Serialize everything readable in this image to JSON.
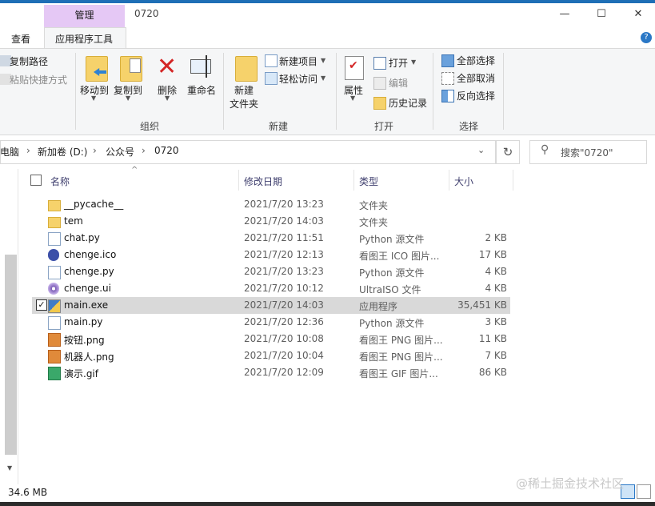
{
  "window": {
    "context_group": "管理",
    "title": "0720",
    "tabs": [
      "查看",
      "应用程序工具"
    ]
  },
  "ribbon": {
    "clipboard_items": [
      "复制路径",
      "粘贴快捷方式"
    ],
    "organize": {
      "buttons": [
        "移动到",
        "复制到",
        "删除",
        "重命名"
      ],
      "group": "组织"
    },
    "new": {
      "new_folder_line1": "新建",
      "new_folder_line2": "文件夹",
      "new_item": "新建项目",
      "easy_access": "轻松访问",
      "group": "新建"
    },
    "open": {
      "properties": "属性",
      "open": "打开",
      "edit": "编辑",
      "history": "历史记录",
      "group": "打开"
    },
    "select": {
      "select_all": "全部选择",
      "select_none": "全部取消",
      "invert": "反向选择",
      "group": "选择"
    }
  },
  "address": {
    "crumbs": [
      "电脑",
      "新加卷 (D:)",
      "公众号",
      "0720"
    ],
    "search_placeholder": "搜索\"0720\""
  },
  "columns": {
    "name": "名称",
    "date": "修改日期",
    "type": "类型",
    "size": "大小"
  },
  "files": [
    {
      "name": "__pycache__",
      "date": "2021/7/20 13:23",
      "type": "文件夹",
      "size": "",
      "icon": "folder-icon"
    },
    {
      "name": "tem",
      "date": "2021/7/20 14:03",
      "type": "文件夹",
      "size": "",
      "icon": "folder-icon"
    },
    {
      "name": "chat.py",
      "date": "2021/7/20 11:51",
      "type": "Python 源文件",
      "size": "2 KB",
      "icon": "python-file-icon"
    },
    {
      "name": "chenge.ico",
      "date": "2021/7/20 12:13",
      "type": "看图王 ICO 图片...",
      "size": "17 KB",
      "icon": "ico-file-icon"
    },
    {
      "name": "chenge.py",
      "date": "2021/7/20 13:23",
      "type": "Python 源文件",
      "size": "4 KB",
      "icon": "python-file-icon"
    },
    {
      "name": "chenge.ui",
      "date": "2021/7/20 10:12",
      "type": "UltraISO 文件",
      "size": "4 KB",
      "icon": "ultraiso-file-icon"
    },
    {
      "name": "main.exe",
      "date": "2021/7/20 14:03",
      "type": "应用程序",
      "size": "35,451 KB",
      "icon": "exe-file-icon",
      "selected": true
    },
    {
      "name": "main.py",
      "date": "2021/7/20 12:36",
      "type": "Python 源文件",
      "size": "3 KB",
      "icon": "python-file-icon"
    },
    {
      "name": "按钮.png",
      "date": "2021/7/20 10:08",
      "type": "看图王 PNG 图片...",
      "size": "11 KB",
      "icon": "png-file-icon"
    },
    {
      "name": "机器人.png",
      "date": "2021/7/20 10:04",
      "type": "看图王 PNG 图片...",
      "size": "7 KB",
      "icon": "png-file-icon"
    },
    {
      "name": "演示.gif",
      "date": "2021/7/20 12:09",
      "type": "看图王 GIF 图片...",
      "size": "86 KB",
      "icon": "gif-file-icon"
    }
  ],
  "status": {
    "selected_size": "34.6 MB"
  },
  "watermark": "@稀土掘金技术社区",
  "colors": {
    "context_tab": "#e5c8f5",
    "selection": "#d9d9d9",
    "delete_red": "#d42626",
    "accent": "#1e6fb6"
  }
}
